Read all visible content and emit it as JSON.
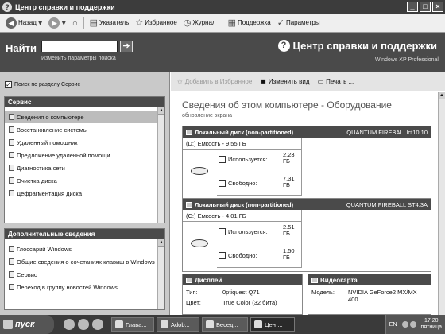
{
  "window": {
    "title": "Центр справки и поддержки"
  },
  "toolbar": {
    "back": "Назад",
    "index": "Указатель",
    "favorites": "Избранное",
    "history": "Журнал",
    "support": "Поддержка",
    "options": "Параметры"
  },
  "search": {
    "label": "Найти",
    "value": "",
    "options_link": "Изменить параметры поиска"
  },
  "brand": {
    "title": "Центр справки и поддержки",
    "subtitle": "Windows XP Professional"
  },
  "left": {
    "search_in_checkbox": "Поиск по разделу Сервис",
    "service": {
      "header": "Сервис",
      "items": [
        "Сведения о компьютере",
        "Восстановление системы",
        "Удаленный помощник",
        "Предложение удаленной помощи",
        "Диагностика сети",
        "Очистка диска",
        "Дефрагментация диска"
      ]
    },
    "extra": {
      "header": "Дополнительные сведения",
      "items": [
        "Глоссарий Windows",
        "Общие сведения о сочетаниях клавиш в Windows",
        "Сервис",
        "Переход в группу новостей Windows"
      ]
    }
  },
  "content": {
    "toolbar": {
      "add_favorites": "Добавить в Избранное",
      "change_view": "Изменить вид",
      "print": "Печать ..."
    },
    "title": "Сведения об этом компьютере - Оборудование",
    "subtitle": "обновление экрана",
    "disks": [
      {
        "header": "Локальный диск  (non-partitioned)",
        "model": "QUANTUM FIREBALLlct10 10",
        "capacity": "(D:) Емкость - 9.55 ГБ",
        "used_label": "Используется:",
        "used_value": "2.23",
        "used_unit": "ГБ",
        "free_label": "Свободно:",
        "free_value": "7.31",
        "free_unit": "ГБ"
      },
      {
        "header": "Локальный диск  (non-partitioned)",
        "model": "QUANTUM FIREBALL ST4.3A",
        "capacity": "(C:) Емкость - 4.01 ГБ",
        "used_label": "Используется:",
        "used_value": "2.51",
        "used_unit": "ГБ",
        "free_label": "Свободно:",
        "free_value": "1.50",
        "free_unit": "ГБ"
      }
    ],
    "display": {
      "header": "Дисплей",
      "type_label": "Тип:",
      "type_value": "0ptiquest Q71",
      "color_label": "Цвет:",
      "color_value": "True Color (32 бита)"
    },
    "video": {
      "header": "Видеокарта",
      "model_label": "Модель:",
      "model_value": "NVIDIA GeForce2 MX/MX 400"
    }
  },
  "taskbar": {
    "start": "пуск",
    "tasks": [
      "Глава...",
      "Adob...",
      "Бесед...",
      "Цент..."
    ],
    "active_task": 3,
    "lang": "EN",
    "time": "17:20",
    "day": "пятница"
  }
}
